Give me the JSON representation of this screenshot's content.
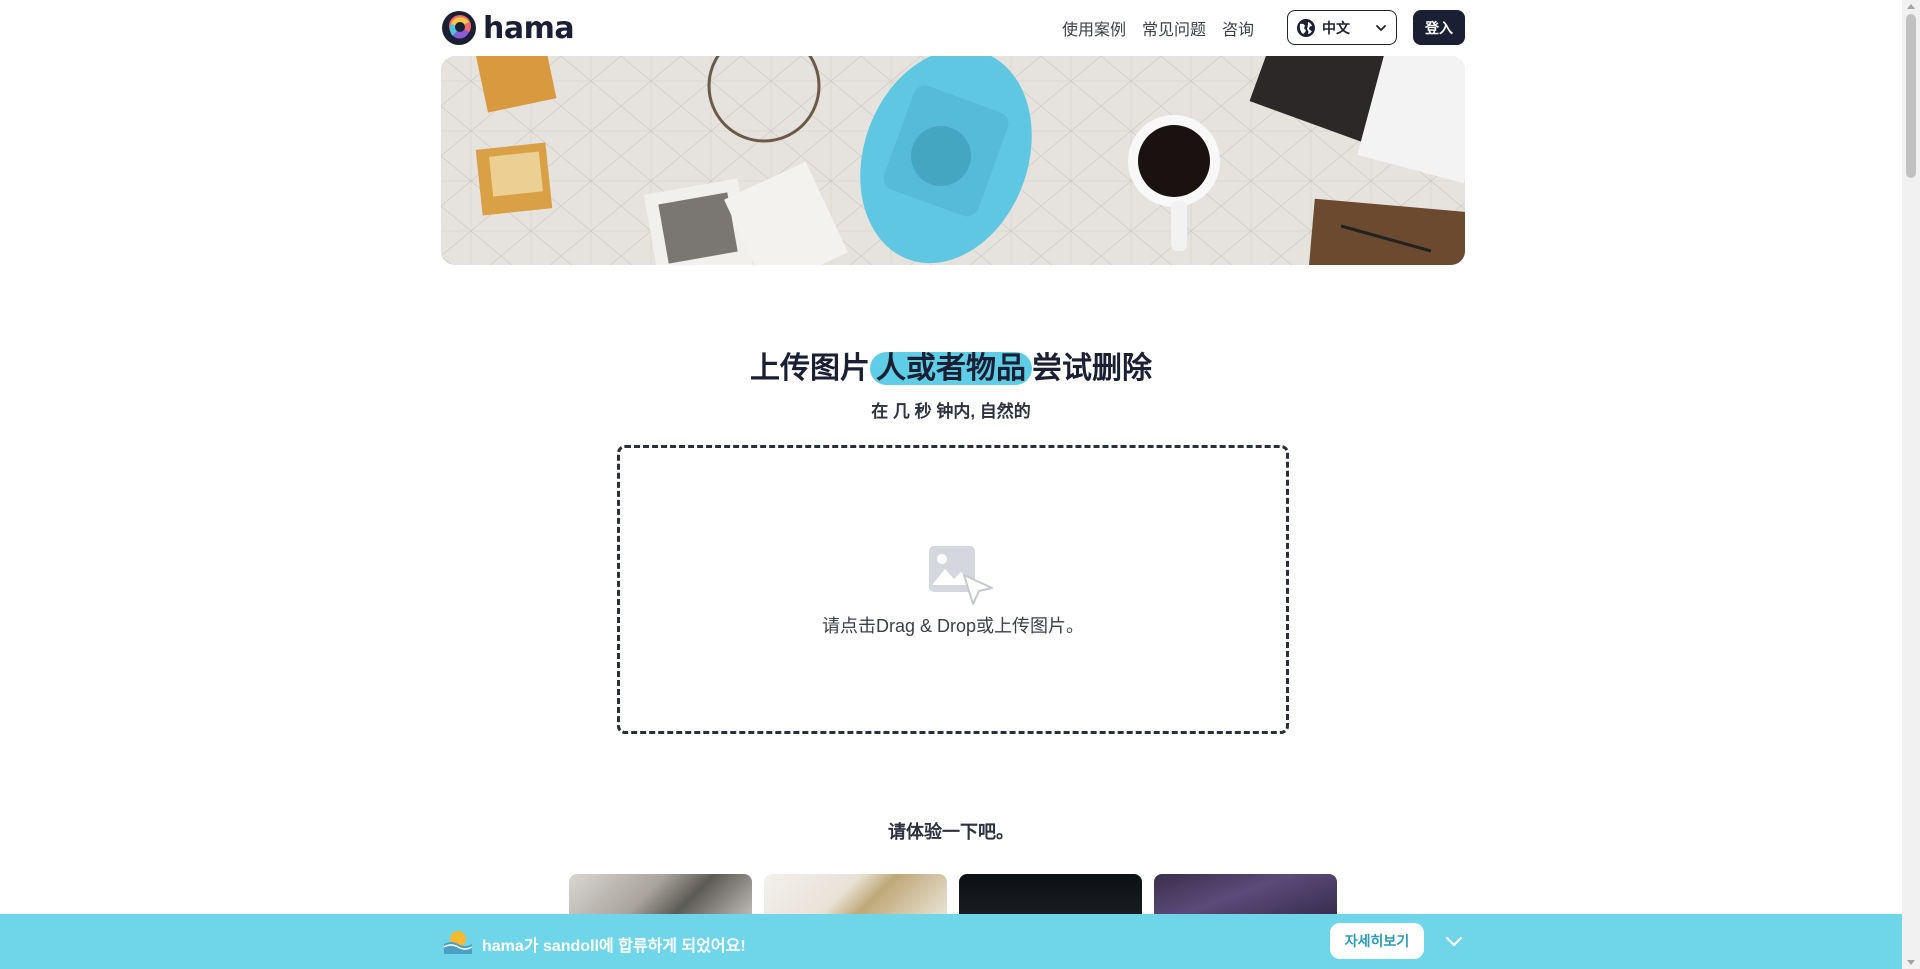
{
  "header": {
    "logo_text": "hama",
    "nav": [
      "使用案例",
      "常见问题",
      "咨询"
    ],
    "language": "中文",
    "login_label": "登入"
  },
  "main": {
    "title_before": "上传图片",
    "title_highlight": "人或者物品",
    "title_after": "尝试删除",
    "subtitle": "在 几 秒 钟内, 自然的",
    "dropzone_text": "请点击Drag & Drop或上传图片。",
    "try_title": "请体验一下吧。"
  },
  "banner": {
    "text": "hama가 sandoll에 합류하게 되었어요!",
    "button_label": "자세히보기"
  },
  "colors": {
    "accent": "#5fcde6",
    "banner": "#6fd6ea",
    "dark": "#1a1f33"
  },
  "icons": [
    "logo-icon",
    "globe-icon",
    "chevron-down-icon",
    "image-upload-icon",
    "cursor-icon",
    "sandoll-icon"
  ]
}
